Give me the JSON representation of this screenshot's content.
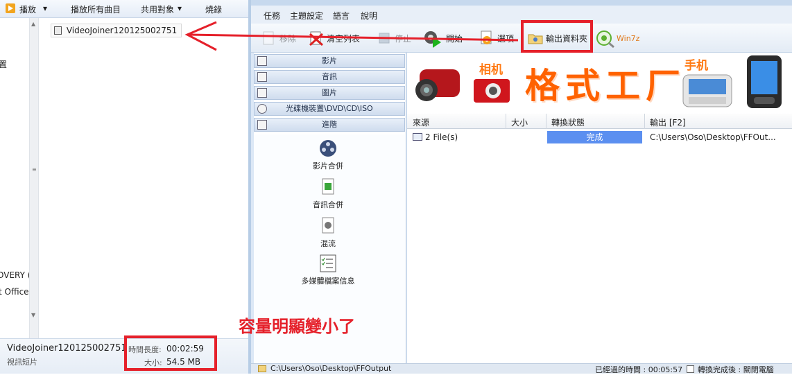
{
  "explorer": {
    "toolbar": {
      "play": "播放",
      "play_all": "播放所有曲目",
      "share": "共用對象",
      "burn": "燒錄"
    },
    "nav_fragments": [
      "置",
      "OVERY (",
      "t Office"
    ],
    "file_name": "VideoJoiner120125002751",
    "details": {
      "name": "VideoJoiner120125002751",
      "type": "視訊短片",
      "length_label": "時間長度:",
      "length_value": "00:02:59",
      "size_label": "大小:",
      "size_value": "54.5 MB"
    }
  },
  "app": {
    "menu": [
      "任務",
      "主題設定",
      "語言",
      "說明"
    ],
    "toolbar": {
      "remove": "移除",
      "clear": "清空列表",
      "stop": "停止",
      "start": "開始",
      "options": "選項",
      "output_folder": "輸出資料夾",
      "win7z": "Win7z"
    },
    "categories": [
      "影片",
      "音訊",
      "圖片",
      "光碟機裝置\\DVD\\CD\\ISO",
      "進階"
    ],
    "advanced_tools": [
      "影片合併",
      "音訊合併",
      "混流",
      "多媒體檔案信息"
    ],
    "banner": {
      "title": "格式工厂",
      "camera_tag": "相机",
      "phone_tag": "手机"
    },
    "list": {
      "columns": [
        "來源",
        "大小",
        "轉換狀態",
        "輸出 [F2]"
      ],
      "rows": [
        {
          "source": "2 File(s)",
          "size": "",
          "status": "完成",
          "output": "C:\\Users\\Oso\\Desktop\\FFOut..."
        }
      ]
    },
    "status_bar": {
      "path": "C:\\Users\\Oso\\Desktop\\FFOutput",
      "elapsed": "已經過的時間 : 00:05:57",
      "after_done": "轉換完成後 : 關閉電腦"
    }
  },
  "annotation": {
    "text": "容量明顯變小了"
  },
  "colors": {
    "annotation_red": "#e5202a",
    "status_blue": "#5b8ff0",
    "banner_orange": "#ff6200"
  }
}
